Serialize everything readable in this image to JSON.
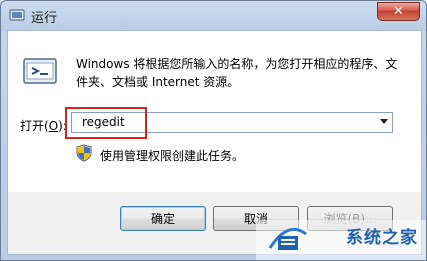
{
  "window": {
    "title": "运行",
    "close_glyph": "✕"
  },
  "dialog": {
    "description": "Windows 将根据您所输入的名称，为您打开相应的程序、文件夹、文档或 Internet 资源。",
    "open_label_prefix": "打开(",
    "open_label_hotkey": "O",
    "open_label_suffix": "):",
    "input_value": "regedit",
    "admin_text": "使用管理权限创建此任务。"
  },
  "buttons": {
    "ok": "确定",
    "cancel": "取消",
    "browse": "浏览(B)..."
  },
  "watermark": {
    "text": "系统之家"
  },
  "colors": {
    "highlight": "#e02020",
    "watermark": "#1e62b5"
  },
  "icons": [
    "run-icon",
    "shield-icon",
    "close-icon",
    "dropdown-arrow-icon",
    "watermark-logo-icon"
  ]
}
